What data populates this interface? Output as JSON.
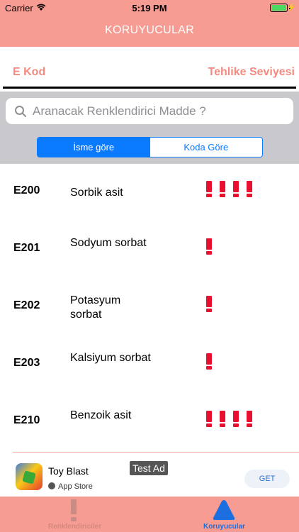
{
  "status_bar": {
    "carrier": "Carrier",
    "time": "5:19 PM"
  },
  "nav": {
    "title": "KORUYUCULAR"
  },
  "columns": {
    "left": "E Kod",
    "right": "Tehlike Seviyesi"
  },
  "search": {
    "placeholder": "Aranacak Renklendirici Madde ?",
    "value": ""
  },
  "segments": [
    {
      "label": "İsme göre",
      "selected": true
    },
    {
      "label": "Koda Göre",
      "selected": false
    }
  ],
  "items": [
    {
      "code": "E200",
      "name": "Sorbik asit",
      "danger_level": 4
    },
    {
      "code": "E201",
      "name": "Sodyum sorbat",
      "danger_level": 1
    },
    {
      "code": "E202",
      "name": "Potasyum sorbat",
      "danger_level": 1
    },
    {
      "code": "E203",
      "name": "Kalsiyum sorbat",
      "danger_level": 1
    },
    {
      "code": "E210",
      "name": "Benzoik asit",
      "danger_level": 4
    }
  ],
  "ad": {
    "app_name": "Toy Blast",
    "store": "App Store",
    "badge": "Test Ad",
    "cta": "GET"
  },
  "tabbar": [
    {
      "label": "Renklendiriciler",
      "icon": "exclamation-icon",
      "selected": false
    },
    {
      "label": "Koruyucular",
      "icon": "triangle-icon",
      "selected": true
    }
  ],
  "colors": {
    "brand": "#f79c93",
    "accent_text": "#f48a80",
    "danger": "#e8102e",
    "ios_blue": "#0a7aff"
  }
}
